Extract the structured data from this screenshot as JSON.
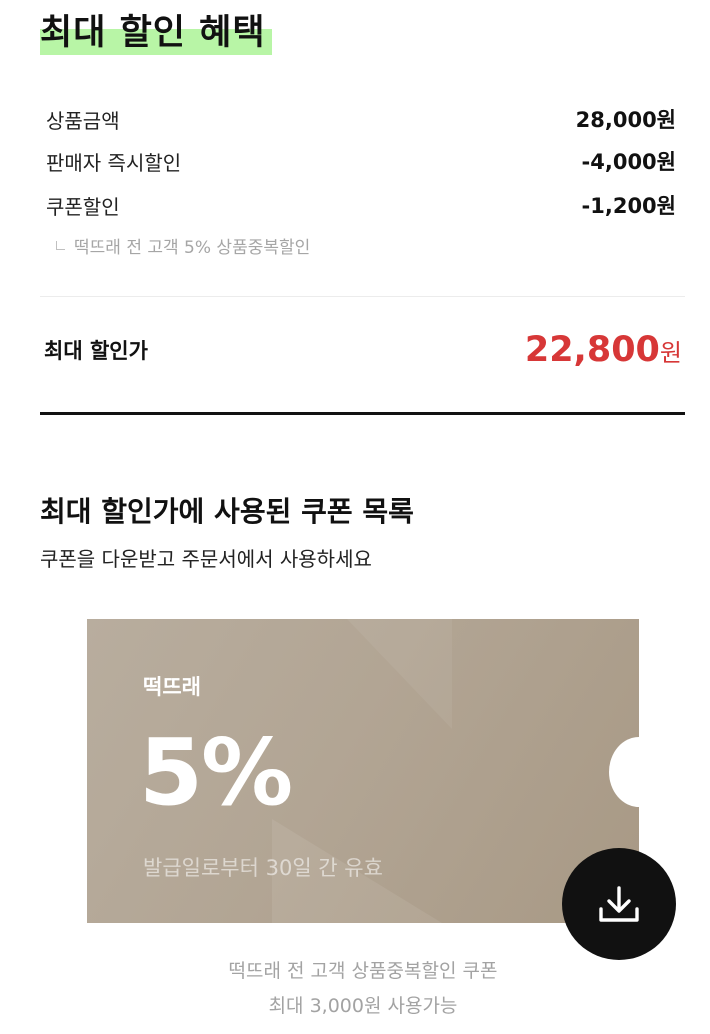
{
  "header": {
    "title": "최대 할인 혜택",
    "highlight_color": "#b8f5a6"
  },
  "price_breakdown": {
    "rows": [
      {
        "label": "상품금액",
        "value": "28,000원"
      },
      {
        "label": "판매자 즉시할인",
        "value": "-4,000원"
      },
      {
        "label": "쿠폰할인",
        "value": "-1,200원"
      }
    ],
    "coupon_detail": "떡뜨래 전 고객 5% 상품중복할인",
    "total_label": "최대 할인가",
    "total_amount": "22,800",
    "total_unit": "원",
    "total_color": "#d73737"
  },
  "coupon_section": {
    "title": "최대 할인가에 사용된 쿠폰 목록",
    "subtitle": "쿠폰을 다운받고 주문서에서 사용하세요"
  },
  "coupon": {
    "brand": "떡뜨래",
    "discount": "5%",
    "validity": "발급일로부터 30일 간 유효",
    "description_line1": "떡뜨래 전 고객 상품중복할인 쿠폰",
    "description_line2": "최대 3,000원 사용가능",
    "card_color": "#b2a594",
    "download_icon": "download-icon"
  }
}
